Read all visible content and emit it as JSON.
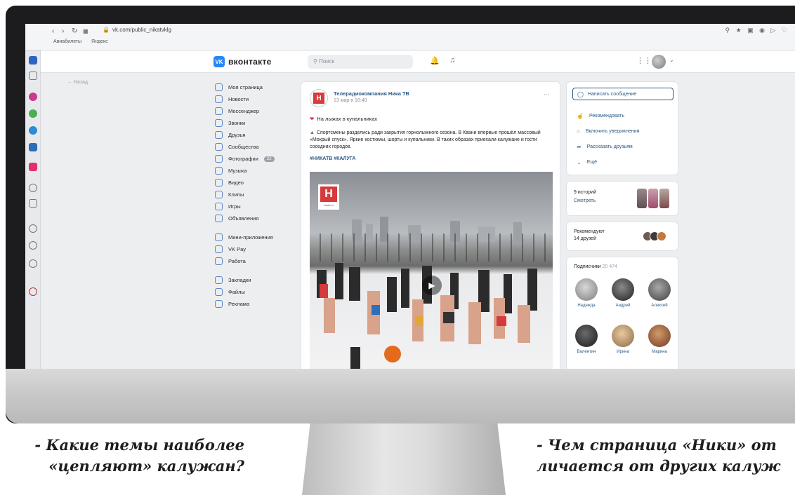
{
  "browser": {
    "url": "vk.com/public_nikatvklg",
    "bookmarks": [
      "Авиабилеты",
      "Яндекс"
    ]
  },
  "vk": {
    "logo_text": "вконтакте",
    "search_placeholder": "Поиск",
    "back_label": "Назад",
    "menu": [
      {
        "label": "Моя страница"
      },
      {
        "label": "Новости"
      },
      {
        "label": "Мессенджер"
      },
      {
        "label": "Звонки"
      },
      {
        "label": "Друзья"
      },
      {
        "label": "Сообщества"
      },
      {
        "label": "Фотографии",
        "badge": "22"
      },
      {
        "label": "Музыка"
      },
      {
        "label": "Видео"
      },
      {
        "label": "Клипы"
      },
      {
        "label": "Игры"
      },
      {
        "label": "Объявления"
      },
      {
        "label": "Мини-приложения"
      },
      {
        "label": "VK Pay"
      },
      {
        "label": "Работа"
      },
      {
        "label": "Закладки"
      },
      {
        "label": "Файлы"
      },
      {
        "label": "Реклама"
      }
    ]
  },
  "post": {
    "author": "Телерадиокомпания Ника ТВ",
    "date": "13 мар в 16:40",
    "heading": "На лыжах в купальниках",
    "body": "Спортсмены разделись ради закрытия горнолыжного сезона. В Квани впервые прошёл массовый «Мокрый спуск». Яркие костюмы, шорты и купальники. В таких образах приехали калужане и гости соседних городов.",
    "tags": "#НИКАТВ #КАЛУГА",
    "photo_logo_letter": "H",
    "photo_logo_sub": "nikatv.ru"
  },
  "sidebar": {
    "actions": {
      "primary": "Написать сообщение",
      "items": [
        "Рекомендовать",
        "Включить уведомления",
        "Рассказать друзьям",
        "Ещё"
      ]
    },
    "stories": {
      "text": "9 историй",
      "link": "Смотреть"
    },
    "recommend": {
      "line1": "Рекомендуют",
      "line2": "14 друзей"
    },
    "subscribers": {
      "title": "Подписчики",
      "count": "20 474",
      "people": [
        "Надежда",
        "Андрей",
        "Алексей",
        "Валентин",
        "Ирина",
        "Марина"
      ]
    }
  },
  "captions": {
    "left": "- Какие темы наиболее «цепляют» калужан?",
    "right_line1": "- Чем страница «Ники» от",
    "right_line2": "личается от других калуж"
  }
}
